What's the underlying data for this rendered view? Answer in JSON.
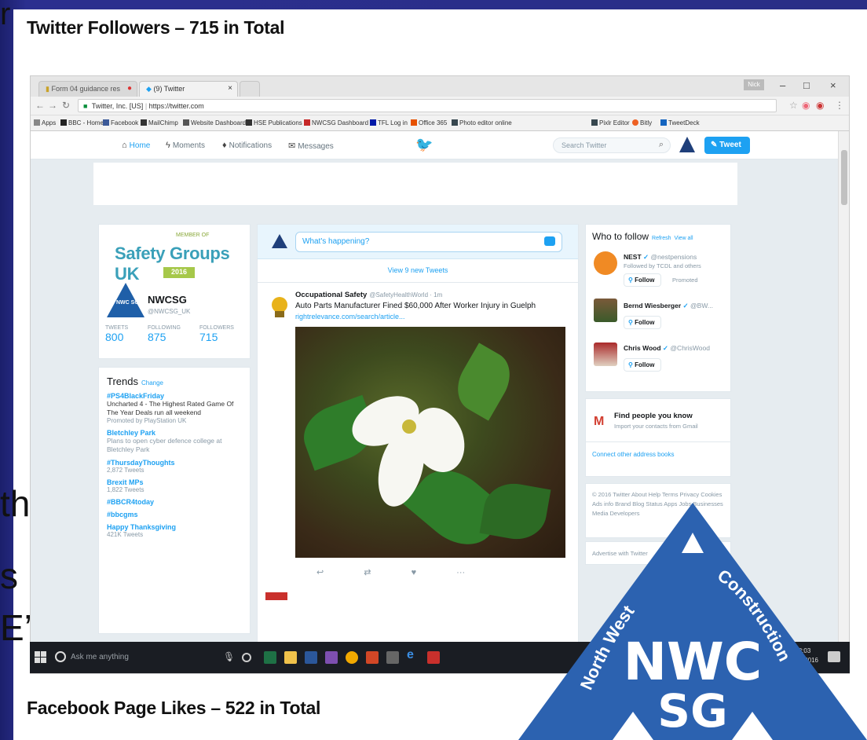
{
  "slide": {
    "top_caption": "Twitter Followers – 715 in Total",
    "bottom_caption": "Facebook Page Likes – 522 in Total",
    "underlay_top_char": "r",
    "underlay_lines": [
      "the",
      "s",
      "E’s"
    ],
    "colors": {
      "slide_bg": "#2a2e86",
      "twitter_blue": "#1da1f2",
      "logo_blue": "#1f5fa8"
    }
  },
  "browser": {
    "tabs": [
      {
        "label": "Form 04 guidance res",
        "icon": "document-icon"
      },
      {
        "label": "(9) Twitter",
        "icon": "twitter-icon"
      }
    ],
    "user_badge": "Nick",
    "window_controls": [
      "–",
      "□",
      "×"
    ],
    "address": {
      "site": "Twitter, Inc. [US]",
      "url": "https://twitter.com"
    },
    "bookmarks": [
      "Apps",
      "BBC - Home",
      "Facebook",
      "MailChimp",
      "Website Dashboard",
      "HSE Publications",
      "NWCSG Dashboard",
      "TFL Log in",
      "Office 365",
      "Photo editor online",
      "Pixlr Editor",
      "Bitly",
      "TweetDeck"
    ]
  },
  "twitter": {
    "nav": [
      "Home",
      "Moments",
      "Notifications",
      "Messages"
    ],
    "search_placeholder": "Search Twitter",
    "tweet_button": "Tweet",
    "profile": {
      "logo_small": "MEMBER OF",
      "logo_title": "Safety Groups UK",
      "logo_year": "2016",
      "avatar_text": "NWC SG",
      "name": "NWCSG",
      "handle": "@NWCSG_UK",
      "stats": [
        {
          "label": "TWEETS",
          "value": "800"
        },
        {
          "label": "FOLLOWING",
          "value": "875"
        },
        {
          "label": "FOLLOWERS",
          "value": "715"
        }
      ]
    },
    "trends": {
      "title": "Trends",
      "change": "Change",
      "items": [
        {
          "name": "#PS4BlackFriday",
          "desc": "Uncharted 4 - The Highest Rated Game Of The Year Deals run all weekend",
          "count": "Promoted by PlayStation UK"
        },
        {
          "name": "Bletchley Park",
          "desc": "Plans to open cyber defence college at Bletchley Park",
          "count": ""
        },
        {
          "name": "#ThursdayThoughts",
          "desc": "",
          "count": "2,872 Tweets"
        },
        {
          "name": "Brexit MPs",
          "desc": "",
          "count": "1,822 Tweets"
        },
        {
          "name": "#BBCR4today",
          "desc": "",
          "count": ""
        },
        {
          "name": "#bbcgms",
          "desc": "",
          "count": ""
        },
        {
          "name": "Happy Thanksgiving",
          "desc": "",
          "count": "421K Tweets"
        }
      ]
    },
    "compose_placeholder": "What's happening?",
    "new_tweets": "View 9 new Tweets",
    "tweet": {
      "author": "Occupational Safety",
      "handle": "@SafetyHealthWorld · 1m",
      "text": "Auto Parts Manufacturer Fined $60,000 After Worker Injury in Guelph",
      "link": "rightrelevance.com/search/article..."
    },
    "tweet_actions": [
      "↩",
      "⇄",
      "♥",
      "···"
    ],
    "who_to_follow": {
      "title": "Who to follow",
      "refresh": "Refresh",
      "view_all": "View all",
      "follow_label": "Follow",
      "suggestions": [
        {
          "name": "NEST",
          "handle": "@nestpensions",
          "sub": "Followed by TCDL and others",
          "promoted": "Promoted"
        },
        {
          "name": "Bernd Wiesberger",
          "handle": "@BW...",
          "sub": "",
          "promoted": ""
        },
        {
          "name": "Chris Wood",
          "handle": "@ChrisWood",
          "sub": "",
          "promoted": ""
        }
      ]
    },
    "find_people": {
      "title": "Find people you know",
      "sub": "Import your contacts from Gmail",
      "connect": "Connect other address books"
    },
    "footer": "© 2016 Twitter  About  Help  Terms  Privacy  Cookies  Ads info  Brand  Blog  Status  Apps  Jobs  Businesses  Media  Developers",
    "advertise": "Advertise with Twitter"
  },
  "taskbar": {
    "search_placeholder": "Ask me anything",
    "time": "08:03",
    "date": "24/11/2016"
  },
  "logo": {
    "arc_left": "North West",
    "arc_right": "Construction",
    "line1": "NWC",
    "line2": "SG"
  }
}
